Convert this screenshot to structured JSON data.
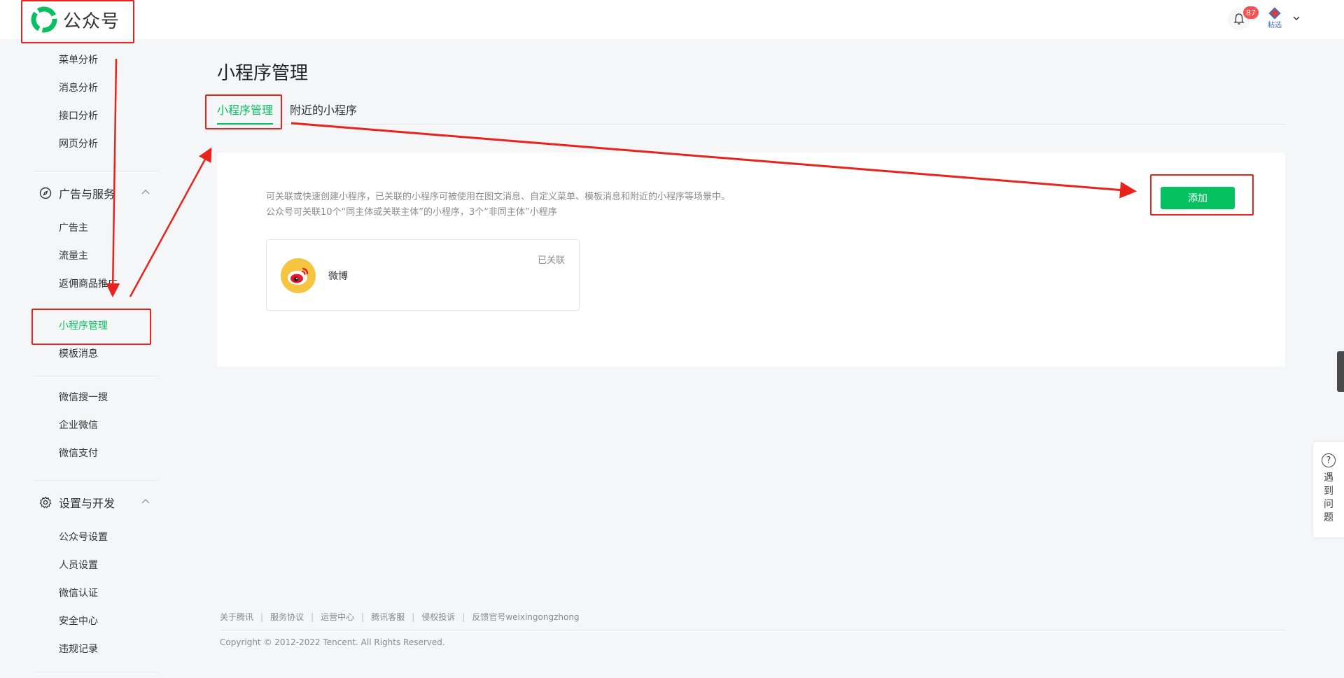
{
  "header": {
    "logo_text": "公众号",
    "notification_count": "87",
    "avatar_label": "粘选"
  },
  "sidebar": {
    "items_top": [
      {
        "label": "菜单分析"
      },
      {
        "label": "消息分析"
      },
      {
        "label": "接口分析"
      },
      {
        "label": "网页分析"
      }
    ],
    "group_ads": {
      "label": "广告与服务",
      "items": [
        {
          "label": "广告主"
        },
        {
          "label": "流量主"
        },
        {
          "label": "返佣商品推广"
        },
        {
          "label": "小程序管理",
          "active": true
        },
        {
          "label": "模板消息"
        },
        {
          "label": "微信搜一搜"
        },
        {
          "label": "企业微信"
        },
        {
          "label": "微信支付"
        }
      ]
    },
    "group_settings": {
      "label": "设置与开发",
      "items": [
        {
          "label": "公众号设置"
        },
        {
          "label": "人员设置"
        },
        {
          "label": "微信认证"
        },
        {
          "label": "安全中心"
        },
        {
          "label": "违规记录"
        }
      ]
    }
  },
  "main": {
    "page_title": "小程序管理",
    "tabs": [
      {
        "label": "小程序管理",
        "active": true
      },
      {
        "label": "附近的小程序"
      }
    ],
    "description_line1": "可关联或快速创建小程序，已关联的小程序可被使用在图文消息、自定义菜单、模板消息和附近的小程序等场景中。",
    "description_line2": "公众号可关联10个“同主体或关联主体”的小程序，3个“非同主体”小程序",
    "add_button": "添加",
    "linked_apps": [
      {
        "name": "微博",
        "status": "已关联",
        "logo_icon": "weibo-icon"
      }
    ]
  },
  "footer": {
    "links": [
      "关于腾讯",
      "服务协议",
      "运营中心",
      "腾讯客服",
      "侵权投诉",
      "反馈官号weixingongzhong"
    ],
    "copyright": "Copyright © 2012-2022 Tencent. All Rights Reserved."
  },
  "help_widget": {
    "text": "遇到问题"
  },
  "colors": {
    "accent": "#07c160",
    "annotation": "#e9231b",
    "badge": "#fa5151"
  }
}
